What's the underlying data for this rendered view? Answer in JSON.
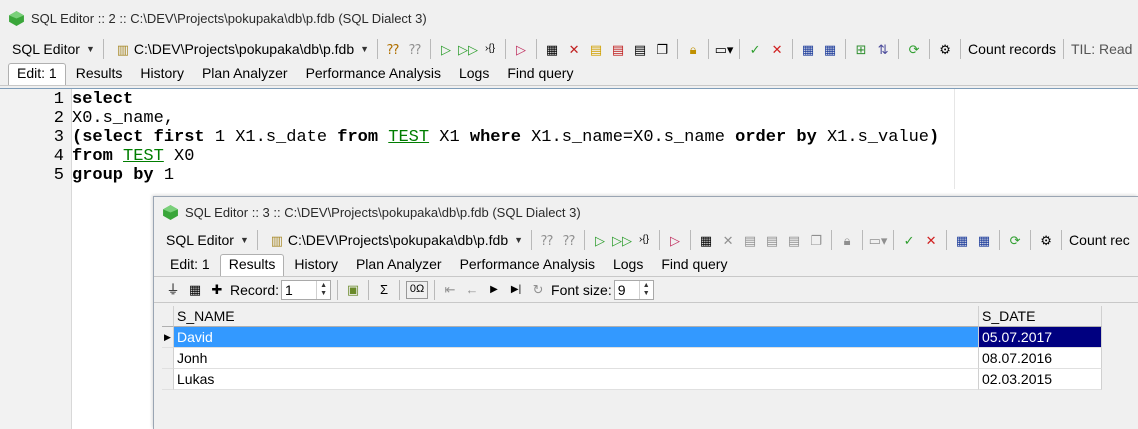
{
  "window1": {
    "title": "SQL Editor :: 2 :: C:\\DEV\\Projects\\pokupaka\\db\\p.fdb (SQL Dialect 3)",
    "toolbar": {
      "editor_combo": "SQL Editor",
      "database_combo": "C:\\DEV\\Projects\\pokupaka\\db\\p.fdb",
      "count_records": "Count records",
      "til": "TIL: Read"
    },
    "tabs": [
      {
        "label": "Edit: 1",
        "accel": "E",
        "active": true
      },
      {
        "label": "Results",
        "accel": "s",
        "active": false
      },
      {
        "label": "History",
        "active": false
      },
      {
        "label": "Plan Analyzer",
        "active": false
      },
      {
        "label": "Performance Analysis",
        "active": false
      },
      {
        "label": "Logs",
        "active": false
      },
      {
        "label": "Find query",
        "active": false
      }
    ],
    "code_lines": [
      {
        "num": "1",
        "text": "select"
      },
      {
        "num": "2",
        "text": "X0.s_name,"
      },
      {
        "num": "3",
        "text": "(select first 1 X1.s_date from TEST X1 where X1.s_name=X0.s_name order by X1.s_value)"
      },
      {
        "num": "4",
        "text": "from TEST X0"
      },
      {
        "num": "5",
        "text": "group by 1"
      }
    ]
  },
  "window2": {
    "title": "SQL Editor :: 3 :: C:\\DEV\\Projects\\pokupaka\\db\\p.fdb (SQL Dialect 3)",
    "toolbar": {
      "editor_combo": "SQL Editor",
      "database_combo": "C:\\DEV\\Projects\\pokupaka\\db\\p.fdb",
      "count_records": "Count rec"
    },
    "tabs": [
      {
        "label": "Edit: 1",
        "active": false
      },
      {
        "label": "Results",
        "active": true
      },
      {
        "label": "History",
        "active": false
      },
      {
        "label": "Plan Analyzer",
        "active": false
      },
      {
        "label": "Performance Analysis",
        "active": false
      },
      {
        "label": "Logs",
        "active": false
      },
      {
        "label": "Find query",
        "active": false
      }
    ],
    "grid_toolbar": {
      "record_label": "Record:",
      "record_value": "1",
      "sigma": "Σ",
      "omega": "0Ω",
      "font_size_label": "Font size:",
      "font_size_value": "9"
    },
    "grid": {
      "columns": [
        "S_NAME",
        "S_DATE"
      ],
      "rows": [
        {
          "s_name": "David",
          "s_date": "05.07.2017",
          "selected": true
        },
        {
          "s_name": "Jonh",
          "s_date": "08.07.2016",
          "selected": false
        },
        {
          "s_name": "Lukas",
          "s_date": "02.03.2015",
          "selected": false
        }
      ]
    }
  },
  "colors": {
    "selection": "#3399ff",
    "selection_focused_cell": "#000080",
    "table_ref": "#007d00",
    "run_green": "#2e9e2e",
    "cancel_red": "#d02020"
  }
}
